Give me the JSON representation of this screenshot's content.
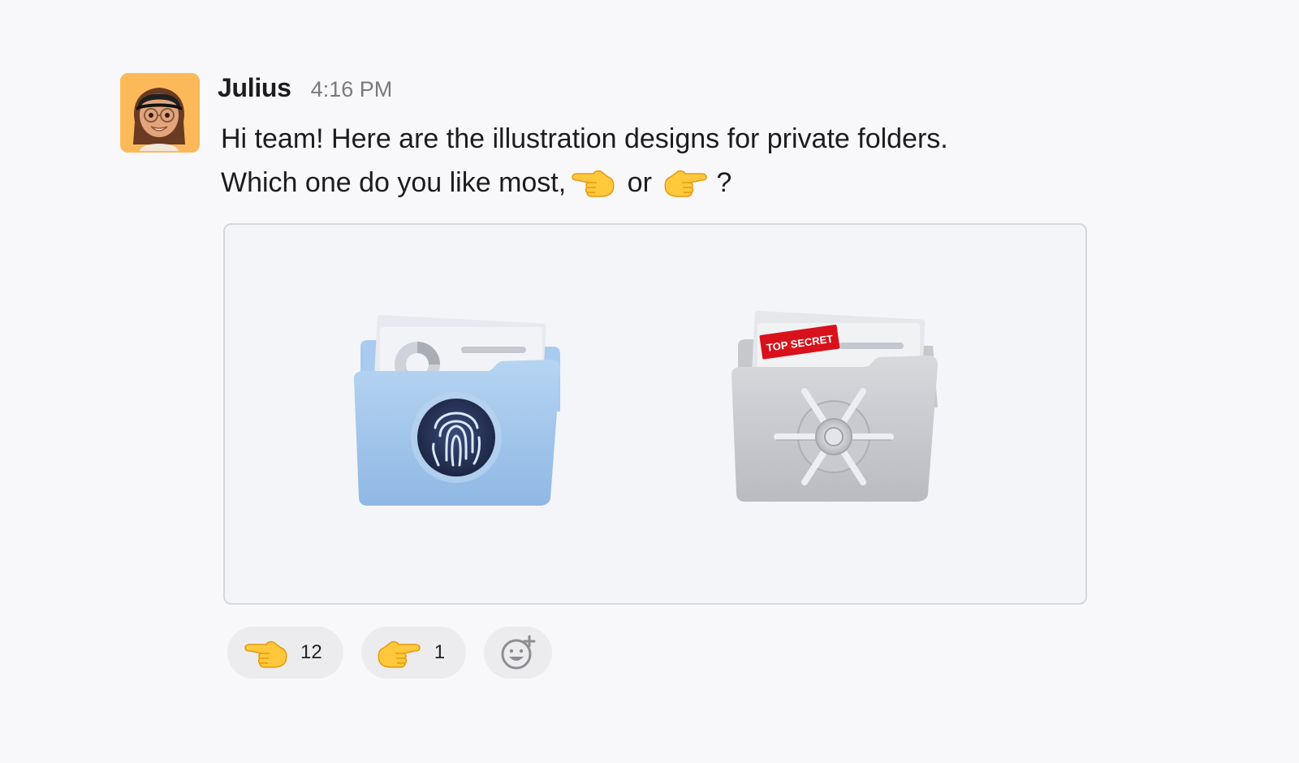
{
  "message": {
    "author": "Julius",
    "timestamp": "4:16 PM",
    "line1": "Hi team! Here are the illustration designs for private folders.",
    "line2_prefix": "Which one do you like most,",
    "line2_or": "or",
    "line2_suffix": "?"
  },
  "attachment": {
    "folder_left_icon": "fingerprint-folder-icon",
    "folder_right_icon": "vault-folder-icon",
    "stamp_text": "TOP SECRET"
  },
  "reactions": [
    {
      "emoji": "backhand-index-pointing-left",
      "count": "12"
    },
    {
      "emoji": "backhand-index-pointing-right",
      "count": "1"
    }
  ],
  "add_reaction_icon": "add-reaction-icon",
  "colors": {
    "avatar_bg": "#fbb95a",
    "folder_blue": "#9cc3ea",
    "folder_gray": "#c7c8cc",
    "stamp_red": "#d8111b",
    "reaction_bg": "#ececef"
  }
}
